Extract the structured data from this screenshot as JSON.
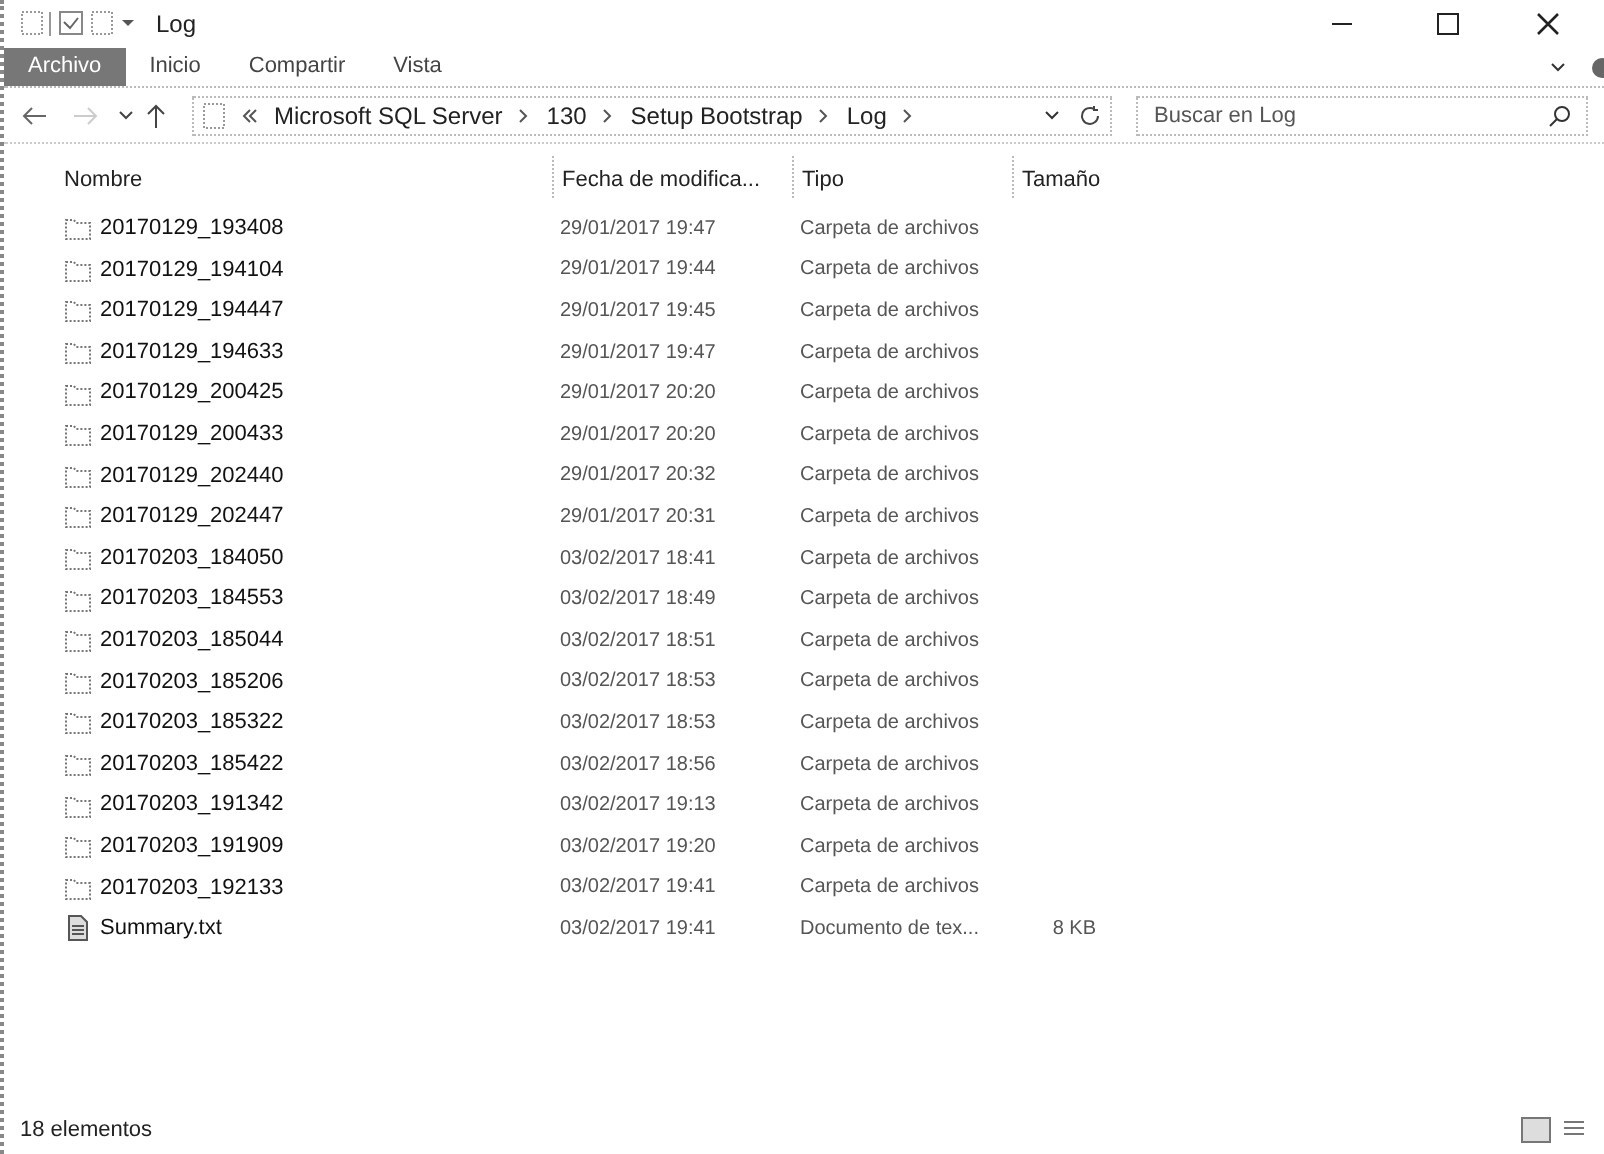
{
  "window": {
    "title": "Log"
  },
  "ribbon_tabs": [
    {
      "label": "Archivo",
      "selected": true
    },
    {
      "label": "Inicio",
      "selected": false
    },
    {
      "label": "Compartir",
      "selected": false
    },
    {
      "label": "Vista",
      "selected": false
    }
  ],
  "breadcrumb": [
    "Microsoft SQL Server",
    "130",
    "Setup Bootstrap",
    "Log"
  ],
  "search": {
    "placeholder": "Buscar en Log"
  },
  "table": {
    "columns": [
      "Nombre",
      "Fecha de modifica...",
      "Tipo",
      "Tamaño"
    ],
    "rows": [
      {
        "kind": "folder",
        "name": "20170129_193408",
        "date": "29/01/2017 19:47",
        "type": "Carpeta de archivos"
      },
      {
        "kind": "folder",
        "name": "20170129_194104",
        "date": "29/01/2017 19:44",
        "type": "Carpeta de archivos"
      },
      {
        "kind": "folder",
        "name": "20170129_194447",
        "date": "29/01/2017 19:45",
        "type": "Carpeta de archivos"
      },
      {
        "kind": "folder",
        "name": "20170129_194633",
        "date": "29/01/2017 19:47",
        "type": "Carpeta de archivos"
      },
      {
        "kind": "folder",
        "name": "20170129_200425",
        "date": "29/01/2017 20:20",
        "type": "Carpeta de archivos"
      },
      {
        "kind": "folder",
        "name": "20170129_200433",
        "date": "29/01/2017 20:20",
        "type": "Carpeta de archivos"
      },
      {
        "kind": "folder",
        "name": "20170129_202440",
        "date": "29/01/2017 20:32",
        "type": "Carpeta de archivos"
      },
      {
        "kind": "folder",
        "name": "20170129_202447",
        "date": "29/01/2017 20:31",
        "type": "Carpeta de archivos"
      },
      {
        "kind": "folder",
        "name": "20170203_184050",
        "date": "03/02/2017 18:41",
        "type": "Carpeta de archivos"
      },
      {
        "kind": "folder",
        "name": "20170203_184553",
        "date": "03/02/2017 18:49",
        "type": "Carpeta de archivos"
      },
      {
        "kind": "folder",
        "name": "20170203_185044",
        "date": "03/02/2017 18:51",
        "type": "Carpeta de archivos"
      },
      {
        "kind": "folder",
        "name": "20170203_185206",
        "date": "03/02/2017 18:53",
        "type": "Carpeta de archivos"
      },
      {
        "kind": "folder",
        "name": "20170203_185322",
        "date": "03/02/2017 18:53",
        "type": "Carpeta de archivos"
      },
      {
        "kind": "folder",
        "name": "20170203_185422",
        "date": "03/02/2017 18:56",
        "type": "Carpeta de archivos"
      },
      {
        "kind": "folder",
        "name": "20170203_191342",
        "date": "03/02/2017 19:13",
        "type": "Carpeta de archivos"
      },
      {
        "kind": "folder",
        "name": "20170203_191909",
        "date": "03/02/2017 19:20",
        "type": "Carpeta de archivos"
      },
      {
        "kind": "folder",
        "name": "20170203_192133",
        "date": "03/02/2017 19:41",
        "type": "Carpeta de archivos"
      },
      {
        "kind": "file",
        "name": "Summary.txt",
        "date": "03/02/2017 19:41",
        "type": "Documento de tex...",
        "size": "8 KB"
      }
    ]
  },
  "status_bar": {
    "count": "18 elementos"
  }
}
